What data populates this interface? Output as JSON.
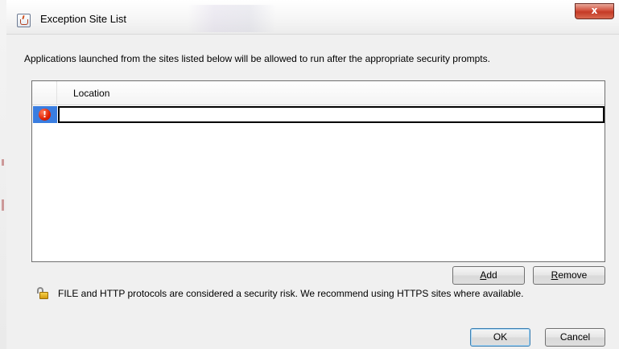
{
  "window": {
    "title": "Exception Site List",
    "close_label": "x"
  },
  "description": "Applications launched from the sites listed below will be allowed to run after the appropriate security prompts.",
  "table": {
    "columns": [
      "Location"
    ],
    "rows": [
      {
        "location": "",
        "status_icon": "error-icon",
        "editing": true
      }
    ],
    "selection_color": "#3a7de0"
  },
  "buttons": {
    "add": {
      "mnemonic": "A",
      "rest": "dd"
    },
    "remove": {
      "mnemonic": "R",
      "rest": "emove"
    },
    "ok": "OK",
    "cancel": "Cancel"
  },
  "notice": "FILE and HTTP protocols are considered a security risk.  We recommend using HTTPS sites where available.",
  "icons": {
    "title": "java-icon",
    "row_status": "error-icon",
    "notice": "lock-icon"
  },
  "colors": {
    "close_button": "#c43a26",
    "error": "#e02000",
    "lock": "#d49a10"
  }
}
